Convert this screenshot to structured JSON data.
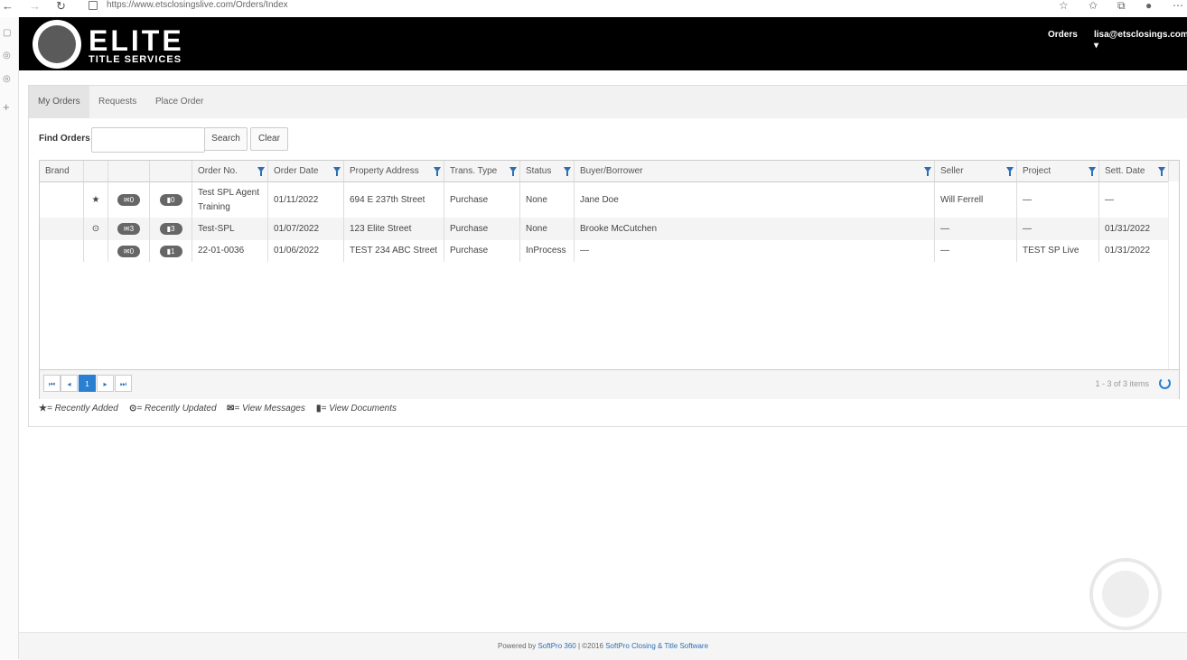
{
  "browser": {
    "url": "https://www.etsclosingslive.com/Orders/Index",
    "back_icon": "arrow-left-icon",
    "forward_icon": "arrow-right-icon",
    "reload_icon": "reload-icon"
  },
  "header": {
    "logo_text": "ELITE",
    "logo_sub": "TITLE SERVICES",
    "orders_link": "Orders",
    "user_menu": "lisa@etsclosings.com"
  },
  "tabs": [
    {
      "label": "My Orders",
      "active": true
    },
    {
      "label": "Requests",
      "active": false
    },
    {
      "label": "Place Order",
      "active": false
    }
  ],
  "search": {
    "label": "Find Orders",
    "value": "",
    "search_button": "Search",
    "clear_button": "Clear"
  },
  "grid": {
    "columns": [
      "Brand",
      "",
      "",
      "",
      "Order No.",
      "Order Date",
      "Property Address",
      "Trans. Type",
      "Status",
      "Buyer/Borrower",
      "Seller",
      "Project",
      "Sett. Date"
    ],
    "rows": [
      {
        "flag": "★",
        "messages": "0",
        "documents": "0",
        "order_no": "Test SPL Agent Training",
        "order_date": "01/11/2022",
        "address": "694 E 237th Street",
        "trans_type": "Purchase",
        "status": "None",
        "buyer": "Jane Doe",
        "seller": "Will Ferrell",
        "project": "—",
        "sett_date": "—"
      },
      {
        "flag": "⊙",
        "messages": "3",
        "documents": "3",
        "order_no": "Test-SPL",
        "order_date": "01/07/2022",
        "address": "123 Elite Street",
        "trans_type": "Purchase",
        "status": "None",
        "buyer": "Brooke McCutchen",
        "seller": "—",
        "project": "—",
        "sett_date": "01/31/2022"
      },
      {
        "flag": "",
        "messages": "0",
        "documents": "1",
        "order_no": "22-01-0036",
        "order_date": "01/06/2022",
        "address": "TEST 234 ABC Street",
        "trans_type": "Purchase",
        "status": "InProcess",
        "buyer": "—",
        "seller": "—",
        "project": "TEST SP Live",
        "sett_date": "01/31/2022"
      }
    ]
  },
  "pager": {
    "current_page": "1",
    "info": "1 - 3 of 3 items",
    "first": "⏮",
    "prev": "◂",
    "next": "▸",
    "last": "⏭"
  },
  "legend": {
    "recently_added": "= Recently Added",
    "recently_updated": "= Recently Updated",
    "view_messages": "= View Messages",
    "view_documents": "= View Documents"
  },
  "footer": {
    "prefix": "Powered by",
    "softpro360": "SoftPro 360",
    "middle": "| ©2016",
    "company": "SoftPro Closing & Title Software"
  },
  "colors": {
    "header_bg": "#000000",
    "accent": "#2a7fd0",
    "link": "#2a6fb5"
  }
}
